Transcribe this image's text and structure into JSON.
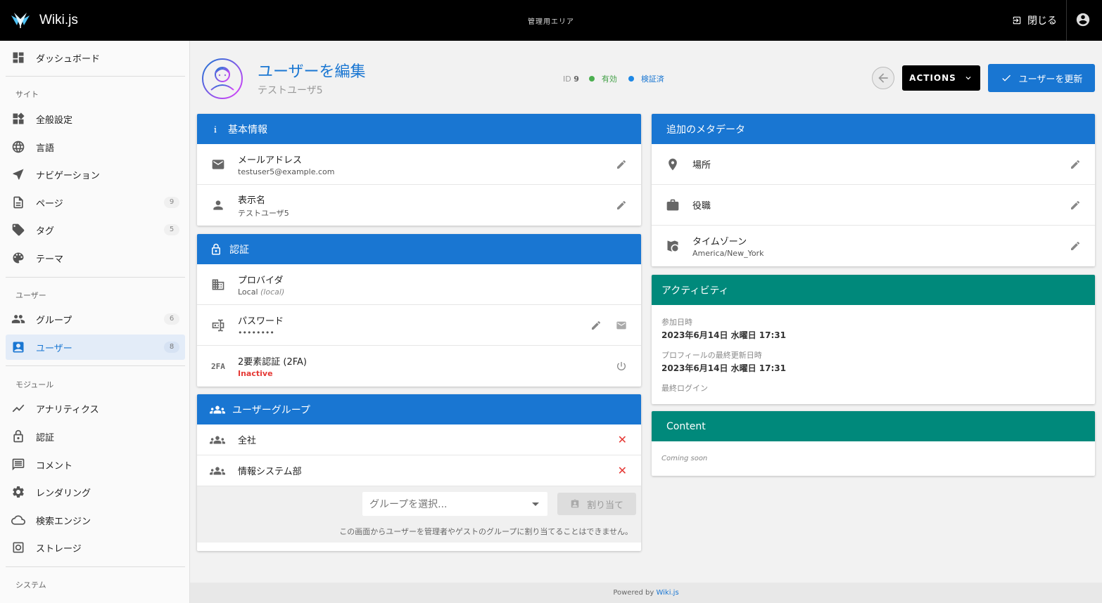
{
  "topbar": {
    "brand": "Wiki.js",
    "area_title": "管理用エリア",
    "close_label": "閉じる"
  },
  "sidebar": {
    "dashboard": "ダッシュボード",
    "section_site": "サイト",
    "site_items": [
      {
        "label": "全般設定",
        "icon": "dashboard-widgets-icon"
      },
      {
        "label": "言語",
        "icon": "globe-icon"
      },
      {
        "label": "ナビゲーション",
        "icon": "navigation-icon"
      },
      {
        "label": "ページ",
        "icon": "page-icon",
        "count": "9"
      },
      {
        "label": "タグ",
        "icon": "tags-icon",
        "count": "5"
      },
      {
        "label": "テーマ",
        "icon": "palette-icon"
      }
    ],
    "section_users": "ユーザー",
    "user_items": [
      {
        "label": "グループ",
        "icon": "groups-icon",
        "count": "6"
      },
      {
        "label": "ユーザー",
        "icon": "user-card-icon",
        "count": "8"
      }
    ],
    "section_modules": "モジュール",
    "module_items": [
      {
        "label": "アナリティクス",
        "icon": "analytics-icon"
      },
      {
        "label": "認証",
        "icon": "lock-icon"
      },
      {
        "label": "コメント",
        "icon": "comment-icon"
      },
      {
        "label": "レンダリング",
        "icon": "gears-icon"
      },
      {
        "label": "検索エンジン",
        "icon": "cloud-search-icon"
      },
      {
        "label": "ストレージ",
        "icon": "storage-icon"
      }
    ],
    "section_system": "システム"
  },
  "header": {
    "title": "ユーザーを編集",
    "subtitle": "テストユーザ5",
    "id_label": "ID",
    "id_value": "9",
    "status_active": "有効",
    "status_verified": "検証済",
    "actions_label": "ACTIONS",
    "update_label": "ユーザーを更新",
    "colors": {
      "active": "#43a047",
      "verified": "#1976d2",
      "accent": "#1976d2"
    }
  },
  "basic": {
    "title": "基本情報",
    "email_label": "メールアドレス",
    "email_value": "testuser5@example.com",
    "name_label": "表示名",
    "name_value": "テストユーザ5"
  },
  "auth": {
    "title": "認証",
    "provider_label": "プロバイダ",
    "provider_value": "Local",
    "provider_note": "(local)",
    "password_label": "パスワード",
    "password_value": "••••••••",
    "tfa_label": "2要素認証 (2FA)",
    "tfa_value": "Inactive",
    "tfa_icon_text": "2FA"
  },
  "groups": {
    "title": "ユーザーグループ",
    "items": [
      "全社",
      "情報システム部"
    ],
    "remove_glyph": "✕",
    "select_placeholder": "グループを選択...",
    "assign_label": "割り当て",
    "note": "この画面からユーザーを管理者やゲストのグループに割り当てることはできません。"
  },
  "metadata": {
    "title": "追加のメタデータ",
    "location_label": "場所",
    "job_label": "役職",
    "timezone_label": "タイムゾーン",
    "timezone_value": "America/New_York"
  },
  "activity": {
    "title": "アクティビティ",
    "joined_label": "参加日時",
    "joined_value": "2023年6月14日 水曜日 17:31",
    "updated_label": "プロフィールの最終更新日時",
    "updated_value": "2023年6月14日 水曜日 17:31",
    "last_login_label": "最終ログイン"
  },
  "content": {
    "title": "Content",
    "value": "Coming soon"
  },
  "footer": {
    "prefix": "Powered by",
    "link": "Wiki.js"
  }
}
